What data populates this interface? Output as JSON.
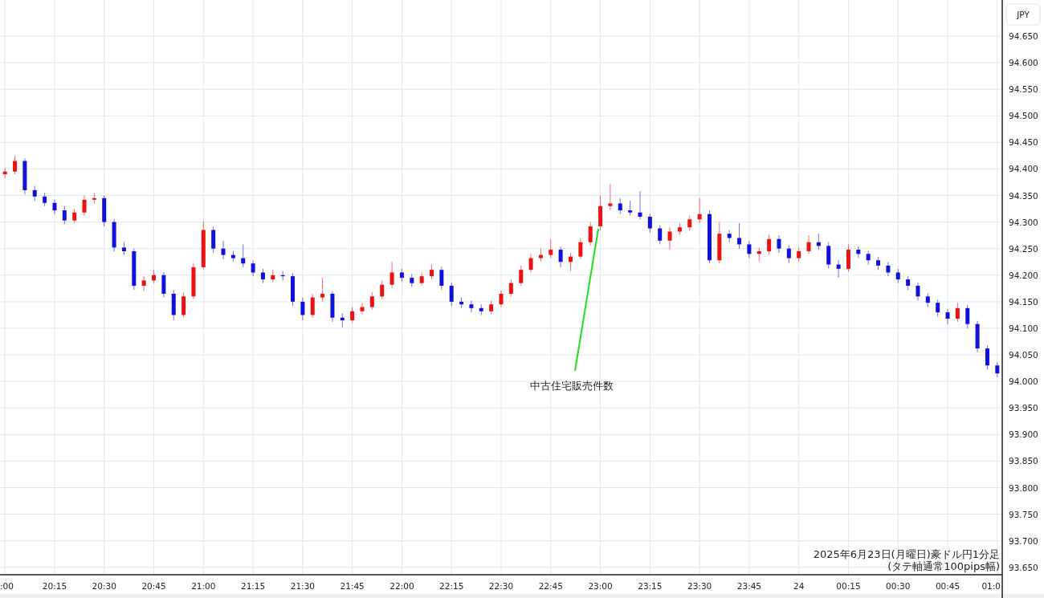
{
  "currency": "JPY",
  "chart_data": {
    "type": "candlestick",
    "grid": true,
    "ylim": [
      93.63,
      94.718
    ],
    "categories": [
      ":00",
      null,
      null,
      null,
      null,
      "20:15",
      null,
      null,
      null,
      null,
      "20:30",
      null,
      null,
      null,
      null,
      "20:45",
      null,
      null,
      null,
      null,
      "21:00",
      null,
      null,
      null,
      null,
      "21:15",
      null,
      null,
      null,
      null,
      "21:30",
      null,
      null,
      null,
      null,
      "21:45",
      null,
      null,
      null,
      null,
      "22:00",
      null,
      null,
      null,
      null,
      "22:15",
      null,
      null,
      null,
      null,
      "22:30",
      null,
      null,
      null,
      null,
      "22:45",
      null,
      null,
      null,
      null,
      "23:00",
      null,
      null,
      null,
      null,
      "23:15",
      null,
      null,
      null,
      null,
      "23:30",
      null,
      null,
      null,
      null,
      "23:45",
      null,
      null,
      null,
      null,
      "24",
      null,
      null,
      null,
      null,
      "00:15",
      null,
      null,
      null,
      null,
      "00:30",
      null,
      null,
      null,
      null,
      "00:45",
      null,
      null,
      null,
      null,
      "01:0"
    ],
    "yticks": [
      {
        "value": 94.65,
        "label": "94.650"
      },
      {
        "value": 94.6,
        "label": "94.600"
      },
      {
        "value": 94.55,
        "label": "94.550"
      },
      {
        "value": 94.5,
        "label": "94.500"
      },
      {
        "value": 94.45,
        "label": "94.450"
      },
      {
        "value": 94.4,
        "label": "94.400"
      },
      {
        "value": 94.35,
        "label": "94.350"
      },
      {
        "value": 94.3,
        "label": "94.300"
      },
      {
        "value": 94.25,
        "label": "94.250"
      },
      {
        "value": 94.2,
        "label": "94.200"
      },
      {
        "value": 94.15,
        "label": "94.150"
      },
      {
        "value": 94.1,
        "label": "94.100"
      },
      {
        "value": 94.05,
        "label": "94.050"
      },
      {
        "value": 94.0,
        "label": "94.000"
      },
      {
        "value": 93.95,
        "label": "93.950"
      },
      {
        "value": 93.9,
        "label": "93.900"
      },
      {
        "value": 93.85,
        "label": "93.850"
      },
      {
        "value": 93.8,
        "label": "93.800"
      },
      {
        "value": 93.75,
        "label": "93.750"
      },
      {
        "value": 93.7,
        "label": "93.700"
      },
      {
        "value": 93.65,
        "label": "93.650"
      }
    ],
    "ohlc": [
      [
        94.39,
        94.402,
        94.383,
        94.395
      ],
      [
        94.395,
        94.425,
        94.39,
        94.415
      ],
      [
        94.415,
        94.42,
        94.352,
        94.36
      ],
      [
        94.36,
        94.368,
        94.34,
        94.348
      ],
      [
        94.348,
        94.355,
        94.33,
        94.336
      ],
      [
        94.336,
        94.342,
        94.315,
        94.322
      ],
      [
        94.322,
        94.33,
        94.296,
        94.303
      ],
      [
        94.303,
        94.325,
        94.298,
        94.318
      ],
      [
        94.318,
        94.35,
        94.312,
        94.342
      ],
      [
        94.342,
        94.355,
        94.335,
        94.345
      ],
      [
        94.345,
        94.35,
        94.292,
        94.3
      ],
      [
        94.3,
        94.306,
        94.244,
        94.252
      ],
      [
        94.252,
        94.262,
        94.238,
        94.245
      ],
      [
        94.245,
        94.25,
        94.172,
        94.18
      ],
      [
        94.18,
        94.198,
        94.17,
        94.19
      ],
      [
        94.19,
        94.21,
        94.185,
        94.2
      ],
      [
        94.2,
        94.206,
        94.158,
        94.165
      ],
      [
        94.165,
        94.172,
        94.115,
        94.125
      ],
      [
        94.125,
        94.168,
        94.12,
        94.16
      ],
      [
        94.16,
        94.222,
        94.155,
        94.215
      ],
      [
        94.215,
        94.302,
        94.21,
        94.285
      ],
      [
        94.285,
        94.292,
        94.242,
        94.25
      ],
      [
        94.25,
        94.265,
        94.23,
        94.238
      ],
      [
        94.238,
        94.246,
        94.225,
        94.232
      ],
      [
        94.232,
        94.258,
        94.215,
        94.222
      ],
      [
        94.222,
        94.228,
        94.198,
        94.205
      ],
      [
        94.205,
        94.212,
        94.185,
        94.192
      ],
      [
        94.192,
        94.21,
        94.186,
        94.2
      ],
      [
        94.2,
        94.208,
        94.19,
        94.198
      ],
      [
        94.198,
        94.204,
        94.142,
        94.15
      ],
      [
        94.15,
        94.158,
        94.115,
        94.125
      ],
      [
        94.125,
        94.165,
        94.12,
        94.158
      ],
      [
        94.158,
        94.195,
        94.15,
        94.165
      ],
      [
        94.165,
        94.17,
        94.112,
        94.12
      ],
      [
        94.12,
        94.128,
        94.102,
        94.115
      ],
      [
        94.115,
        94.14,
        94.11,
        94.132
      ],
      [
        94.132,
        94.148,
        94.126,
        94.14
      ],
      [
        94.14,
        94.168,
        94.135,
        94.16
      ],
      [
        94.16,
        94.19,
        94.155,
        94.182
      ],
      [
        94.182,
        94.225,
        94.176,
        94.205
      ],
      [
        94.205,
        94.212,
        94.188,
        94.195
      ],
      [
        94.195,
        94.202,
        94.178,
        94.185
      ],
      [
        94.185,
        94.205,
        94.18,
        94.198
      ],
      [
        94.198,
        94.22,
        94.192,
        94.21
      ],
      [
        94.21,
        94.216,
        94.172,
        94.18
      ],
      [
        94.18,
        94.186,
        94.142,
        94.15
      ],
      [
        94.15,
        94.158,
        94.138,
        94.145
      ],
      [
        94.145,
        94.152,
        94.13,
        94.138
      ],
      [
        94.138,
        94.145,
        94.125,
        94.132
      ],
      [
        94.132,
        94.152,
        94.126,
        94.145
      ],
      [
        94.145,
        94.172,
        94.14,
        94.165
      ],
      [
        94.165,
        94.192,
        94.16,
        94.185
      ],
      [
        94.185,
        94.218,
        94.18,
        94.21
      ],
      [
        94.21,
        94.24,
        94.205,
        94.232
      ],
      [
        94.232,
        94.25,
        94.226,
        94.238
      ],
      [
        94.238,
        94.268,
        94.232,
        94.248
      ],
      [
        94.248,
        94.254,
        94.215,
        94.225
      ],
      [
        94.225,
        94.242,
        94.208,
        94.235
      ],
      [
        94.235,
        94.27,
        94.23,
        94.262
      ],
      [
        94.262,
        94.3,
        94.256,
        94.292
      ],
      [
        94.292,
        94.35,
        94.285,
        94.33
      ],
      [
        94.33,
        94.372,
        94.322,
        94.335
      ],
      [
        94.335,
        94.345,
        94.315,
        94.322
      ],
      [
        94.322,
        94.34,
        94.312,
        94.318
      ],
      [
        94.318,
        94.358,
        94.305,
        94.31
      ],
      [
        94.31,
        94.316,
        94.28,
        94.288
      ],
      [
        94.288,
        94.294,
        94.258,
        94.265
      ],
      [
        94.265,
        94.29,
        94.248,
        94.282
      ],
      [
        94.282,
        94.298,
        94.276,
        94.29
      ],
      [
        94.29,
        94.312,
        94.284,
        94.305
      ],
      [
        94.305,
        94.345,
        94.298,
        94.315
      ],
      [
        94.315,
        94.322,
        94.222,
        94.228
      ],
      [
        94.228,
        94.3,
        94.222,
        94.278
      ],
      [
        94.278,
        94.285,
        94.262,
        94.27
      ],
      [
        94.27,
        94.298,
        94.25,
        94.258
      ],
      [
        94.258,
        94.265,
        94.232,
        94.24
      ],
      [
        94.24,
        94.252,
        94.226,
        94.245
      ],
      [
        94.245,
        94.276,
        94.238,
        94.268
      ],
      [
        94.268,
        94.275,
        94.242,
        94.25
      ],
      [
        94.25,
        94.256,
        94.222,
        94.232
      ],
      [
        94.232,
        94.252,
        94.226,
        94.245
      ],
      [
        94.245,
        94.275,
        94.24,
        94.262
      ],
      [
        94.262,
        94.278,
        94.248,
        94.255
      ],
      [
        94.255,
        94.262,
        94.212,
        94.22
      ],
      [
        94.22,
        94.228,
        94.195,
        94.212
      ],
      [
        94.212,
        94.258,
        94.206,
        94.248
      ],
      [
        94.248,
        94.254,
        94.232,
        94.24
      ],
      [
        94.24,
        94.246,
        94.22,
        94.228
      ],
      [
        94.228,
        94.234,
        94.21,
        94.218
      ],
      [
        94.218,
        94.225,
        94.198,
        94.205
      ],
      [
        94.205,
        94.212,
        94.185,
        94.192
      ],
      [
        94.192,
        94.198,
        94.172,
        94.18
      ],
      [
        94.18,
        94.186,
        94.152,
        94.16
      ],
      [
        94.16,
        94.166,
        94.14,
        94.148
      ],
      [
        94.148,
        94.154,
        94.122,
        94.13
      ],
      [
        94.13,
        94.136,
        94.108,
        94.118
      ],
      [
        94.118,
        94.148,
        94.112,
        94.138
      ],
      [
        94.138,
        94.144,
        94.1,
        94.108
      ],
      [
        94.108,
        94.114,
        94.055,
        94.062
      ],
      [
        94.062,
        94.068,
        94.022,
        94.03
      ],
      [
        94.03,
        94.036,
        94.008,
        94.015
      ]
    ],
    "annotations": [
      "中古住宅販売件数"
    ]
  },
  "caption": [
    "2025年6月23日(月曜日)豪ドル円1分足",
    "(タテ軸通常100pips幅)"
  ]
}
